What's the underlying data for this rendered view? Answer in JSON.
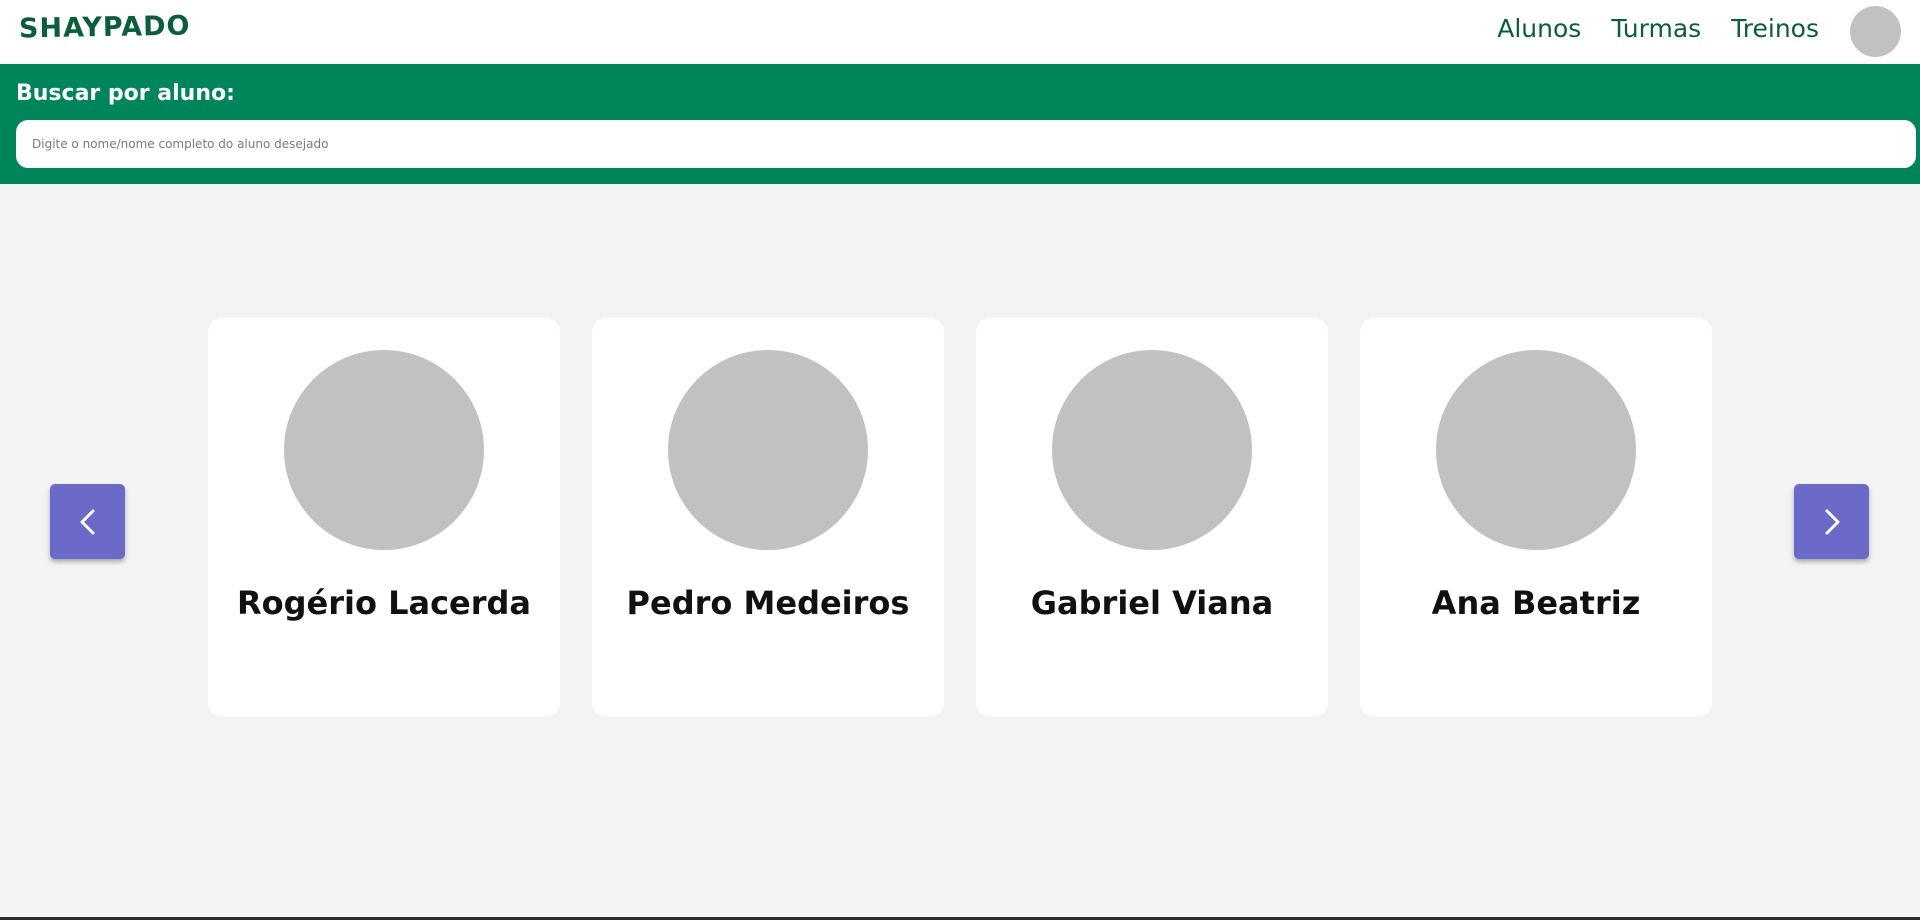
{
  "brand": {
    "logo_text": "SHAYPADO"
  },
  "nav": {
    "links": [
      "Alunos",
      "Turmas",
      "Treinos"
    ]
  },
  "search": {
    "title": "Buscar por aluno:",
    "placeholder": "Digite o nome/nome completo do aluno desejado",
    "value": ""
  },
  "carousel": {
    "prev_icon": "chevron-left-icon",
    "next_icon": "chevron-right-icon",
    "students": [
      {
        "name": "Rogério Lacerda"
      },
      {
        "name": "Pedro Medeiros"
      },
      {
        "name": "Gabriel Viana"
      },
      {
        "name": "Ana Beatriz"
      }
    ]
  },
  "colors": {
    "brand_green": "#0b5e3c",
    "search_band": "#00845a",
    "button_purple": "#6c6ac8",
    "avatar_gray": "#c1c1c1",
    "page_bg": "#f3f3f3"
  }
}
